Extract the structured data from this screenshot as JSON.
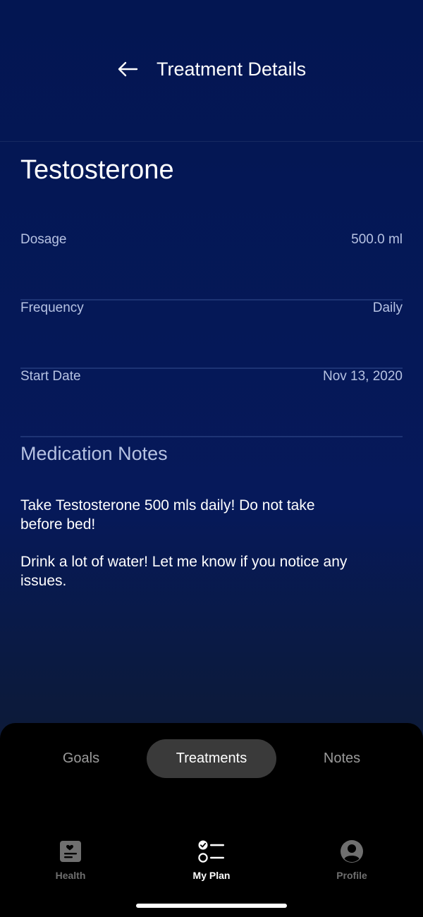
{
  "header": {
    "title": "Treatment Details",
    "back_icon": "arrow-left-icon"
  },
  "medication": {
    "name": "Testosterone",
    "details": [
      {
        "label": "Dosage",
        "value": "500.0 ml"
      },
      {
        "label": "Frequency",
        "value": "Daily"
      },
      {
        "label": "Start Date",
        "value": "Nov 13, 2020"
      }
    ],
    "notes_heading": "Medication Notes",
    "notes": [
      "Take Testosterone 500 mls daily! Do not take before bed!",
      "Drink a lot of water! Let me know if you notice any issues."
    ]
  },
  "segmented_tabs": [
    {
      "label": "Goals",
      "active": false
    },
    {
      "label": "Treatments",
      "active": true
    },
    {
      "label": "Notes",
      "active": false
    }
  ],
  "bottom_nav": [
    {
      "label": "Health",
      "icon": "health-record-icon",
      "active": false
    },
    {
      "label": "My Plan",
      "icon": "checklist-icon",
      "active": true
    },
    {
      "label": "Profile",
      "icon": "person-icon",
      "active": false
    }
  ],
  "colors": {
    "background_top": "#031652",
    "muted_text": "#b6c2e2",
    "sheet": "#000000",
    "active_pill": "#3a3a3a"
  }
}
